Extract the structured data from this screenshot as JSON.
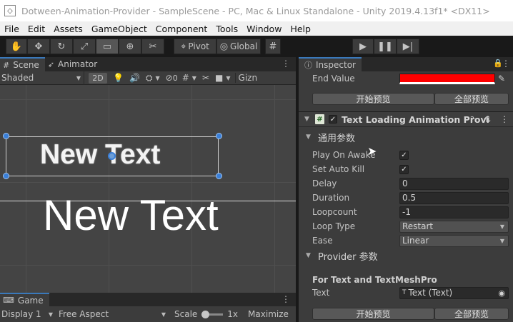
{
  "window": {
    "title": "Dotween-Animation-Provider - SampleScene - PC, Mac & Linux Standalone - Unity 2019.4.13f1* <DX11>"
  },
  "menu": [
    "File",
    "Edit",
    "Assets",
    "GameObject",
    "Component",
    "Tools",
    "Window",
    "Help"
  ],
  "toolbar": {
    "pivot_label": "Pivot",
    "global_label": "Global"
  },
  "scene": {
    "tab_scene": "Scene",
    "tab_animator": "Animator",
    "shading_mode": "Shaded",
    "mode_2d": "2D",
    "hidden_count": "0",
    "gizmos_label": "Gizn",
    "text_selected": "New Text",
    "text_large": "New Text"
  },
  "game": {
    "tab_game": "Game",
    "display": "Display 1",
    "aspect": "Free Aspect",
    "scale_label": "Scale",
    "scale_value": "1x",
    "maximize_label": "Maximize",
    "scale_fraction": 0.0
  },
  "inspector": {
    "tab_label": "Inspector",
    "end_value_label": "End Value",
    "end_value_color": "#ff0000",
    "preview_button": "开始预览",
    "preview_all_button": "全部预览",
    "component_title": "Text Loading Animation Provi",
    "component_enabled": true,
    "common_section": "通用参数",
    "fields": {
      "play_on_awake_label": "Play On Awake",
      "play_on_awake": true,
      "set_auto_kill_label": "Set Auto Kill",
      "set_auto_kill": true,
      "delay_label": "Delay",
      "delay": "0",
      "duration_label": "Duration",
      "duration": "0.5",
      "loopcount_label": "Loopcount",
      "loopcount": "-1",
      "loop_type_label": "Loop Type",
      "loop_type": "Restart",
      "ease_label": "Ease",
      "ease": "Linear"
    },
    "provider_section": "Provider 参数",
    "for_text_label": "For Text  and TextMeshPro",
    "text_label": "Text",
    "text_ref": "Text (Text)",
    "preview_button_2": "开始预览",
    "preview_all_button_2": "全部预览"
  }
}
